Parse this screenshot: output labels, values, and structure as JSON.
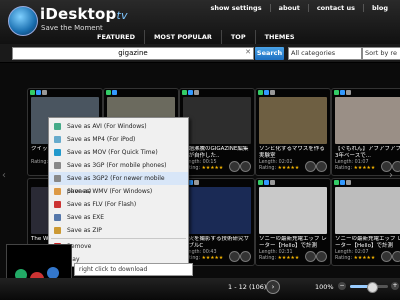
{
  "header": {
    "logo_text": "iDesktop",
    "logo_suffix": "tv",
    "tagline": "Save the Moment",
    "top_links": [
      "show settings",
      "about",
      "contact us",
      "blog"
    ],
    "nav_tabs": [
      "FEATURED",
      "MOST POPULAR",
      "TOP",
      "THEMES"
    ]
  },
  "search": {
    "query": "gigazine",
    "clear_label": "✕",
    "button_label": "Search",
    "category": "All categories",
    "sort": "Sort by re"
  },
  "cards": [
    {
      "title": "クイック...",
      "duration": "",
      "rating": "★★★★★",
      "thumb": "#4a5560"
    },
    {
      "title": "",
      "duration": "",
      "rating": "",
      "thumb": "#6b6a5e"
    },
    {
      "title": "話題沸騰のGIGAZINE編集部が自作した..",
      "duration": "Length: 00:15",
      "rating": "★★★★★",
      "thumb": "#2d2d2d"
    },
    {
      "title": "ソンビ化するマウスを作る実験室",
      "duration": "Length: 02:02",
      "rating": "★★★★★",
      "thumb": "#6e5f42"
    },
    {
      "title": "【ぐもれん】アブアブアブ 3年ベースで...",
      "duration": "Length: 01:07",
      "rating": "★★★★★",
      "thumb": "#9a8f86"
    },
    {
      "title": "The Wh...",
      "duration": "",
      "rating": "",
      "thumb": "#2a2a35"
    },
    {
      "title": "",
      "duration": "",
      "rating": "",
      "thumb": "#3a3a3a"
    },
    {
      "title": "花火を撮影する技術研究サンプルC",
      "duration": "Length: 00:43",
      "rating": "★★★★★",
      "thumb": "#1a2a55"
    },
    {
      "title": "ソニーの最新充電エッブ レーター【Hello】で計測",
      "duration": "Length: 02:31",
      "rating": "★★★★★",
      "thumb": "#c9c9c9"
    },
    {
      "title": "ソニーの最新充電エッブ レーター【Hello】で計測",
      "duration": "Length: 02:07",
      "rating": "★★★★★",
      "thumb": "#bdbdbd"
    }
  ],
  "card_meta_label": "Rating:",
  "context_menu": {
    "items": [
      {
        "label": "Save as AVI (For Windows)",
        "icon_color": "#4a8"
      },
      {
        "label": "Save as MP4 (For iPod)",
        "icon_color": "#6ac"
      },
      {
        "label": "Save as MOV (For Quick Time)",
        "icon_color": "#29c"
      },
      {
        "label": "Save as 3GP (For mobile phones)",
        "icon_color": "#888"
      },
      {
        "label": "Save as 3GP2 (For newer mobile phones)",
        "icon_color": "#888"
      },
      {
        "label": "Save as WMV (For Windows)",
        "icon_color": "#d94"
      },
      {
        "label": "Save as FLV (For Flash)",
        "icon_color": "#c33"
      },
      {
        "label": "Save as EXE",
        "icon_color": "#57a"
      },
      {
        "label": "Save as ZIP",
        "icon_color": "#c93"
      },
      {
        "label": "Remove",
        "icon_color": "#c22"
      },
      {
        "label": "Play",
        "icon_color": "#3a3"
      }
    ],
    "tooltip": "right click to download"
  },
  "pager": {
    "text": "1 - 12 (106)",
    "next": "›"
  },
  "zoom": {
    "label": "100%",
    "minus": "−",
    "plus": "+",
    "level": 0.55
  },
  "nav_arrows": {
    "left": "‹",
    "right": "›"
  },
  "colors": {
    "accent": "#1c6fc0",
    "star": "#f5b400",
    "menu_bg": "#f0f0f0"
  }
}
